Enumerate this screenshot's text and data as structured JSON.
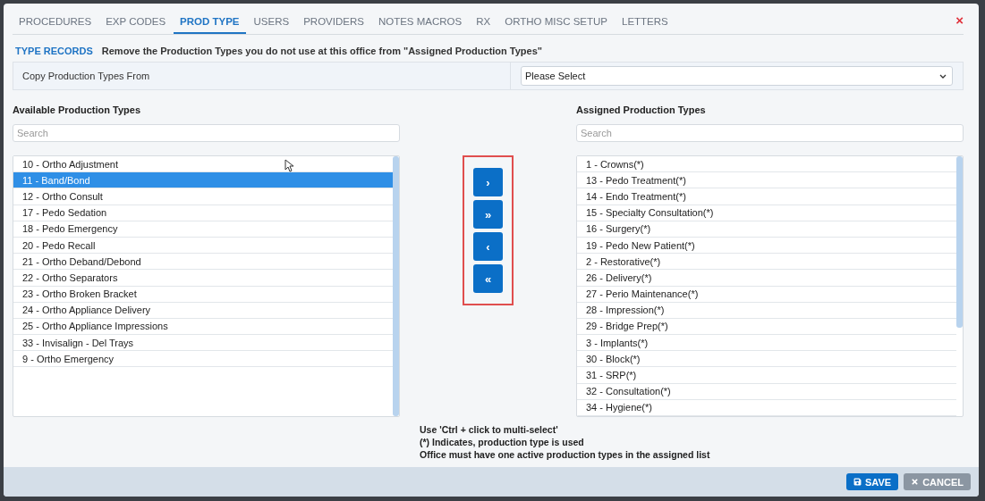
{
  "tabs": [
    {
      "label": "PROCEDURES",
      "selected": false
    },
    {
      "label": "EXP CODES",
      "selected": false
    },
    {
      "label": "PROD TYPE",
      "selected": true
    },
    {
      "label": "USERS",
      "selected": false
    },
    {
      "label": "PROVIDERS",
      "selected": false
    },
    {
      "label": "NOTES MACROS",
      "selected": false
    },
    {
      "label": "RX",
      "selected": false
    },
    {
      "label": "ORTHO MISC SETUP",
      "selected": false
    },
    {
      "label": "LETTERS",
      "selected": false
    }
  ],
  "close": "×",
  "section": {
    "title": "TYPE RECORDS",
    "hint": "Remove the Production Types you do not use at this office from \"Assigned Production Types\""
  },
  "copy_from": {
    "label": "Copy Production Types From",
    "value": "Please Select"
  },
  "available": {
    "heading": "Available Production Types",
    "search": {
      "placeholder": "Search"
    },
    "items": [
      {
        "label": "10 - Ortho Adjustment",
        "selected": false
      },
      {
        "label": "11 - Band/Bond",
        "selected": true
      },
      {
        "label": "12 - Ortho Consult",
        "selected": false
      },
      {
        "label": "17 - Pedo Sedation",
        "selected": false
      },
      {
        "label": "18 - Pedo Emergency",
        "selected": false
      },
      {
        "label": "20 - Pedo Recall",
        "selected": false
      },
      {
        "label": "21 - Ortho Deband/Debond",
        "selected": false
      },
      {
        "label": "22 - Ortho Separators",
        "selected": false
      },
      {
        "label": "23 - Ortho Broken Bracket",
        "selected": false
      },
      {
        "label": "24 - Ortho Appliance Delivery",
        "selected": false
      },
      {
        "label": "25 - Ortho Appliance Impressions",
        "selected": false
      },
      {
        "label": "33 - Invisalign - Del Trays",
        "selected": false
      },
      {
        "label": "9 - Ortho Emergency",
        "selected": false
      }
    ]
  },
  "move_buttons": [
    {
      "label": "›"
    },
    {
      "label": "»"
    },
    {
      "label": "‹"
    },
    {
      "label": "«"
    }
  ],
  "assigned": {
    "heading": "Assigned Production Types",
    "search": {
      "placeholder": "Search"
    },
    "items": [
      {
        "label": "1 - Crowns(*)",
        "selected": false
      },
      {
        "label": "13 - Pedo Treatment(*)",
        "selected": false
      },
      {
        "label": "14 - Endo Treatment(*)",
        "selected": false
      },
      {
        "label": "15 - Specialty Consultation(*)",
        "selected": false
      },
      {
        "label": "16 - Surgery(*)",
        "selected": false
      },
      {
        "label": "19 - Pedo New Patient(*)",
        "selected": false
      },
      {
        "label": "2 - Restorative(*)",
        "selected": false
      },
      {
        "label": "26 - Delivery(*)",
        "selected": false
      },
      {
        "label": "27 - Perio Maintenance(*)",
        "selected": false
      },
      {
        "label": "28 - Impression(*)",
        "selected": false
      },
      {
        "label": "29 - Bridge Prep(*)",
        "selected": false
      },
      {
        "label": "3 - Implants(*)",
        "selected": false
      },
      {
        "label": "30 - Block(*)",
        "selected": false
      },
      {
        "label": "31 - SRP(*)",
        "selected": false
      },
      {
        "label": "32 - Consultation(*)",
        "selected": false
      },
      {
        "label": "34 - Hygiene(*)",
        "selected": false
      }
    ]
  },
  "notes": [
    "Use 'Ctrl + click to multi-select'",
    "(*) Indicates, production type is used",
    "Office must have one active production types in the assigned list"
  ],
  "footer": {
    "save": "SAVE",
    "cancel": "CANCEL"
  }
}
